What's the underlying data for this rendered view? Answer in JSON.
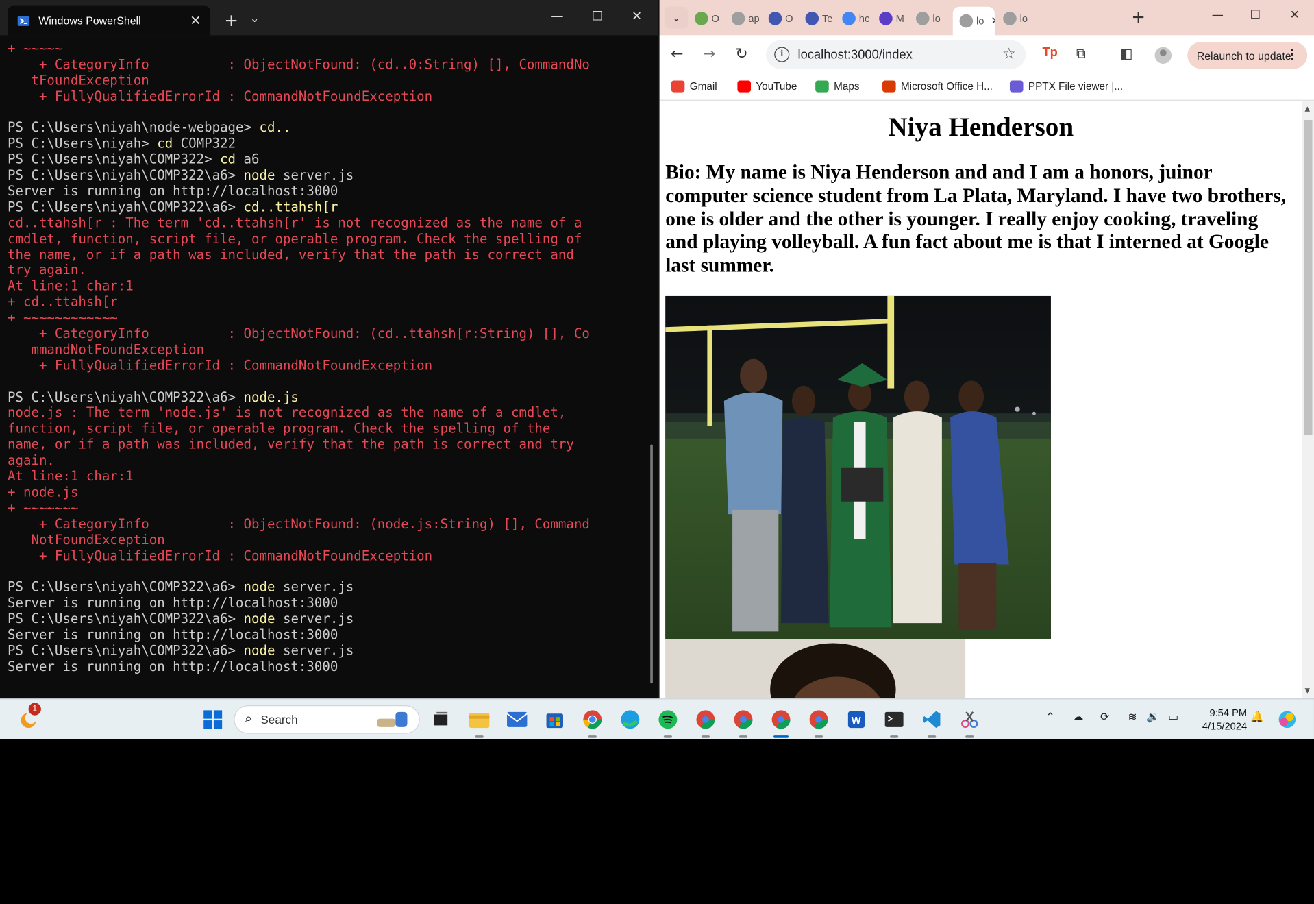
{
  "powershell": {
    "title": "Windows PowerShell",
    "lines": [
      {
        "text": "+ ~~~~~",
        "cls": "c-err"
      },
      {
        "text": "    + CategoryInfo          : ObjectNotFound: (cd..0:String) [], CommandNo",
        "cls": "c-err"
      },
      {
        "text": "   tFoundException",
        "cls": "c-err"
      },
      {
        "text": "    + FullyQualifiedErrorId : CommandNotFoundException",
        "cls": "c-err"
      },
      {
        "text": "",
        "cls": "c-norm"
      },
      {
        "prompt": "PS C:\\Users\\niyah\\node-webpage> ",
        "cmd": "cd.."
      },
      {
        "prompt": "PS C:\\Users\\niyah> ",
        "cmd": "cd",
        "arg": " COMP322"
      },
      {
        "prompt": "PS C:\\Users\\niyah\\COMP322> ",
        "cmd": "cd",
        "arg": " a6"
      },
      {
        "prompt": "PS C:\\Users\\niyah\\COMP322\\a6> ",
        "cmd": "node",
        "arg": " server.js"
      },
      {
        "text": "Server is running on http://localhost:3000",
        "cls": "c-norm"
      },
      {
        "prompt": "PS C:\\Users\\niyah\\COMP322\\a6> ",
        "cmd": "cd..ttahsh[r"
      },
      {
        "text": "cd..ttahsh[r : The term 'cd..ttahsh[r' is not recognized as the name of a",
        "cls": "c-err"
      },
      {
        "text": "cmdlet, function, script file, or operable program. Check the spelling of",
        "cls": "c-err"
      },
      {
        "text": "the name, or if a path was included, verify that the path is correct and",
        "cls": "c-err"
      },
      {
        "text": "try again.",
        "cls": "c-err"
      },
      {
        "text": "At line:1 char:1",
        "cls": "c-err"
      },
      {
        "text": "+ cd..ttahsh[r",
        "cls": "c-err"
      },
      {
        "text": "+ ~~~~~~~~~~~~",
        "cls": "c-err"
      },
      {
        "text": "    + CategoryInfo          : ObjectNotFound: (cd..ttahsh[r:String) [], Co",
        "cls": "c-err"
      },
      {
        "text": "   mmandNotFoundException",
        "cls": "c-err"
      },
      {
        "text": "    + FullyQualifiedErrorId : CommandNotFoundException",
        "cls": "c-err"
      },
      {
        "text": "",
        "cls": "c-norm"
      },
      {
        "prompt": "PS C:\\Users\\niyah\\COMP322\\a6> ",
        "cmd": "node.js"
      },
      {
        "text": "node.js : The term 'node.js' is not recognized as the name of a cmdlet,",
        "cls": "c-err"
      },
      {
        "text": "function, script file, or operable program. Check the spelling of the",
        "cls": "c-err"
      },
      {
        "text": "name, or if a path was included, verify that the path is correct and try",
        "cls": "c-err"
      },
      {
        "text": "again.",
        "cls": "c-err"
      },
      {
        "text": "At line:1 char:1",
        "cls": "c-err"
      },
      {
        "text": "+ node.js",
        "cls": "c-err"
      },
      {
        "text": "+ ~~~~~~~",
        "cls": "c-err"
      },
      {
        "text": "    + CategoryInfo          : ObjectNotFound: (node.js:String) [], Command",
        "cls": "c-err"
      },
      {
        "text": "   NotFoundException",
        "cls": "c-err"
      },
      {
        "text": "    + FullyQualifiedErrorId : CommandNotFoundException",
        "cls": "c-err"
      },
      {
        "text": "",
        "cls": "c-norm"
      },
      {
        "prompt": "PS C:\\Users\\niyah\\COMP322\\a6> ",
        "cmd": "node",
        "arg": " server.js"
      },
      {
        "text": "Server is running on http://localhost:3000",
        "cls": "c-norm"
      },
      {
        "prompt": "PS C:\\Users\\niyah\\COMP322\\a6> ",
        "cmd": "node",
        "arg": " server.js"
      },
      {
        "text": "Server is running on http://localhost:3000",
        "cls": "c-norm"
      },
      {
        "prompt": "PS C:\\Users\\niyah\\COMP322\\a6> ",
        "cmd": "node",
        "arg": " server.js"
      },
      {
        "text": "Server is running on http://localhost:3000",
        "cls": "c-norm"
      }
    ]
  },
  "chrome": {
    "tabs": [
      {
        "label": "O",
        "icon": "owl-icon",
        "color": "#6aa84f"
      },
      {
        "label": "ap",
        "icon": "globe-icon",
        "color": "#9e9e9e"
      },
      {
        "label": "O",
        "icon": "quizlet-icon",
        "color": "#4257b2"
      },
      {
        "label": "Te",
        "icon": "quizlet-icon",
        "color": "#4257b2"
      },
      {
        "label": "hc",
        "icon": "google-icon",
        "color": "#4285f4"
      },
      {
        "label": "M",
        "icon": "d-icon",
        "color": "#5b3cc4"
      },
      {
        "label": "lo",
        "icon": "globe-icon",
        "color": "#9e9e9e"
      },
      {
        "label": "lo",
        "icon": "globe-icon",
        "color": "#9e9e9e",
        "active": true
      },
      {
        "label": "lo",
        "icon": "globe-icon",
        "color": "#9e9e9e"
      }
    ],
    "address": "localhost:3000/index",
    "relaunch_label": "Relaunch to update",
    "bookmarks": [
      {
        "label": "Gmail",
        "icon": "gmail-icon",
        "color": "#ea4335"
      },
      {
        "label": "YouTube",
        "icon": "youtube-icon",
        "color": "#ff0000"
      },
      {
        "label": "Maps",
        "icon": "maps-icon",
        "color": "#34a853"
      },
      {
        "label": "Microsoft Office H...",
        "icon": "office-icon",
        "color": "#d83b01"
      },
      {
        "label": "PPTX File viewer |...",
        "icon": "pptx-icon",
        "color": "#6b5bd6"
      }
    ]
  },
  "page": {
    "title": "Niya Henderson",
    "bio": "Bio: My name is Niya Henderson and and I am a honors, juinor computer science student from La Plata, Maryland. I have two brothers, one is older and the other is younger. I really enjoy cooking, traveling and playing volleyball. A fun fact about me is that I interned at Google last summer."
  },
  "taskbar": {
    "search_label": "Search",
    "time": "9:54 PM",
    "date": "4/15/2024",
    "notification_count": "1"
  }
}
